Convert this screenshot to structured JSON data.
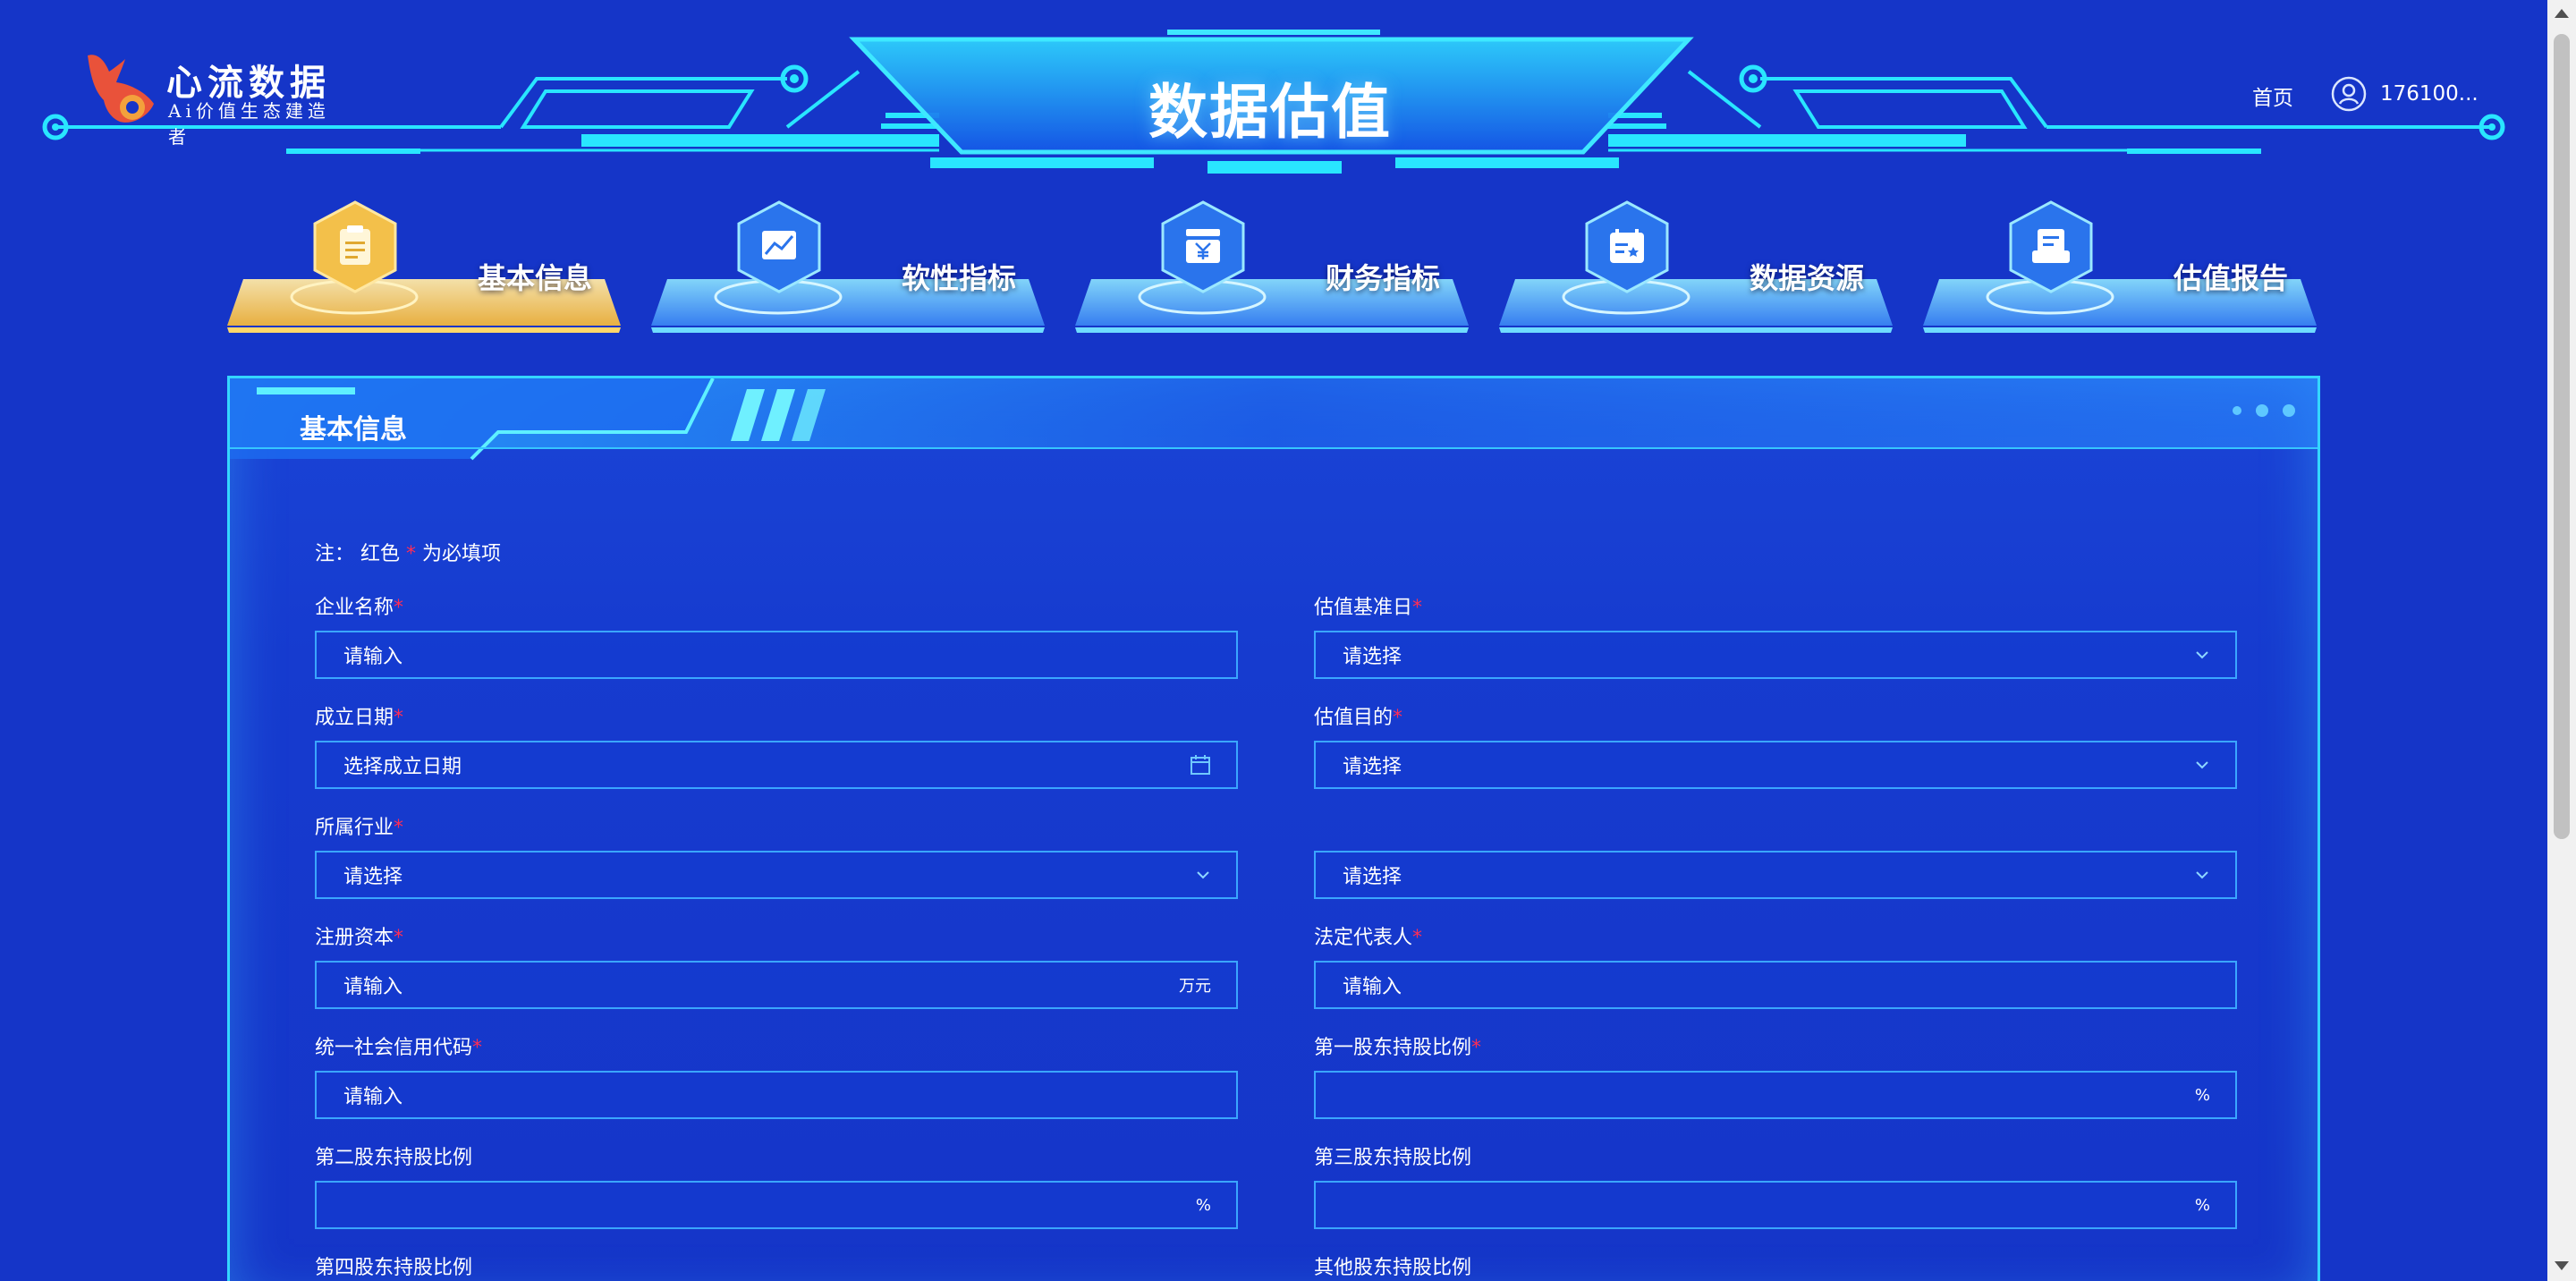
{
  "colors": {
    "background": "#1535c8",
    "accent_cyan": "#34d6ff",
    "active_gold": "#f3c04a",
    "required": "#ff2d55"
  },
  "header": {
    "logo_name": "心流数据",
    "logo_slogan": "Ai价值生态建造者",
    "title": "数据估值",
    "home_label": "首页",
    "user_name": "176100...",
    "user_icon": "user-circle-icon"
  },
  "steps": [
    {
      "label": "基本信息",
      "icon": "clipboard-icon",
      "active": true
    },
    {
      "label": "软性指标",
      "icon": "chart-icon",
      "active": false
    },
    {
      "label": "财务指标",
      "icon": "yen-icon",
      "active": false
    },
    {
      "label": "数据资源",
      "icon": "data-card-icon",
      "active": false
    },
    {
      "label": "估值报告",
      "icon": "report-icon",
      "active": false
    }
  ],
  "panel": {
    "title": "基本信息",
    "note_prefix": "注：",
    "note_color_word": "红色",
    "note_star": "*",
    "note_suffix": "为必填项"
  },
  "form": {
    "company_name": {
      "label": "企业名称",
      "required": "*",
      "placeholder": "请输入"
    },
    "valuation_date": {
      "label": "估值基准日",
      "required": "*",
      "placeholder": "请选择"
    },
    "founding_date": {
      "label": "成立日期",
      "required": "*",
      "placeholder": "选择成立日期"
    },
    "valuation_purpose": {
      "label": "估值目的",
      "required": "*",
      "placeholder": "请选择"
    },
    "industry": {
      "label": "所属行业",
      "required": "*",
      "placeholder": "请选择"
    },
    "purpose_detail": {
      "placeholder": "请选择"
    },
    "registered_capital": {
      "label": "注册资本",
      "required": "*",
      "placeholder": "请输入",
      "unit": "万元"
    },
    "legal_rep": {
      "label": "法定代表人",
      "required": "*",
      "placeholder": "请输入"
    },
    "credit_code": {
      "label": "统一社会信用代码",
      "required": "*",
      "placeholder": "请输入"
    },
    "holder1": {
      "label": "第一股东持股比例",
      "required": "*",
      "unit": "%"
    },
    "holder2": {
      "label": "第二股东持股比例",
      "unit": "%"
    },
    "holder3": {
      "label": "第三股东持股比例",
      "unit": "%"
    },
    "holder4": {
      "label": "第四股东持股比例"
    },
    "holder_other": {
      "label": "其他股东持股比例"
    }
  }
}
